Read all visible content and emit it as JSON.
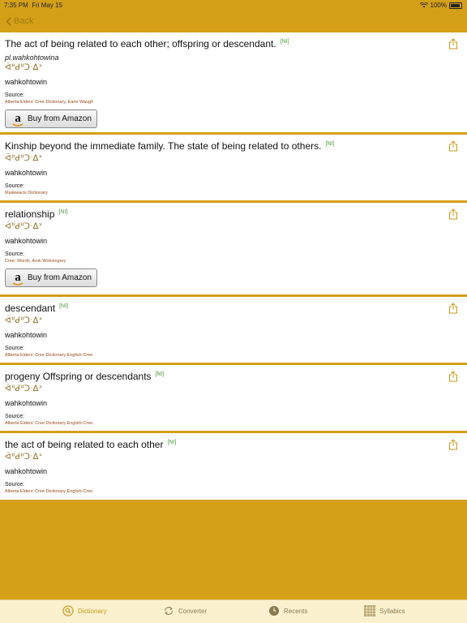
{
  "status": {
    "time": "7:35 PM",
    "date": "Fri May 15",
    "battery": "100%"
  },
  "nav": {
    "back_label": "Back"
  },
  "entries": [
    {
      "definition": "The act of being related to each other; offspring or descendant.",
      "tag": "[NI]",
      "plural": "pl.wahkohtowina",
      "syllabics": "ᐋᐦᑯᐦᑐᐧᐃᐣ",
      "cree": "wahkohtowin",
      "source_label": "Source:",
      "source": "Alberta Elders' Cree Dictionary, Earle Waugh",
      "amazon": "Buy from Amazon"
    },
    {
      "definition": "Kinship beyond the immediate family.  The state of being related to others.",
      "tag": "[NI]",
      "syllabics": "ᐋᐦᑯᐦᑐᐧᐃᐣ",
      "cree": "wahkohtowin",
      "source_label": "Source:",
      "source": "Maskwacis Dictionary"
    },
    {
      "definition": "relationship",
      "tag": "[NI]",
      "syllabics": "ᐋᐦᑯᐦᑐᐧᐃᐣ",
      "cree": "wahkohtowin",
      "source_label": "Source:",
      "source": "Cree: Words, Arok Wolvengrey",
      "amazon": "Buy from Amazon"
    },
    {
      "definition": "descendant",
      "tag": "[NI]",
      "syllabics": "ᐋᐦᑯᐦᑐᐧᐃᐣ",
      "cree": "wahkohtowin",
      "source_label": "Source:",
      "source": "Alberta Elders' Cree Dictionary English-Cree"
    },
    {
      "definition": "progeny  Offspring or descendants",
      "tag": "[NI]",
      "syllabics": "ᐋᐦᑯᐦᑐᐧᐃᐣ",
      "cree": "wahkohtowin",
      "source_label": "Source:",
      "source": "Alberta Elders' Cree Dictionary English-Cree"
    },
    {
      "definition": "the act of being related to each other",
      "tag": "[NI]",
      "syllabics": "ᐋᐦᑯᐦᑐᐧᐃᐣ",
      "cree": "wahkohtowin",
      "source_label": "Source:",
      "source": "Alberta Elders' Cree Dictionary English-Cree"
    }
  ],
  "tabs": [
    {
      "label": "Dictionary",
      "icon": "magnifier-icon",
      "active": true
    },
    {
      "label": "Converter",
      "icon": "convert-icon",
      "active": false
    },
    {
      "label": "Recents",
      "icon": "clock-icon",
      "active": false
    },
    {
      "label": "Syllabics",
      "icon": "grid-icon",
      "active": false
    }
  ],
  "colors": {
    "accent": "#d4a018",
    "tag": "#4a9a3a",
    "source": "#9a4a1a",
    "tabbar": "#fbf1cf"
  }
}
